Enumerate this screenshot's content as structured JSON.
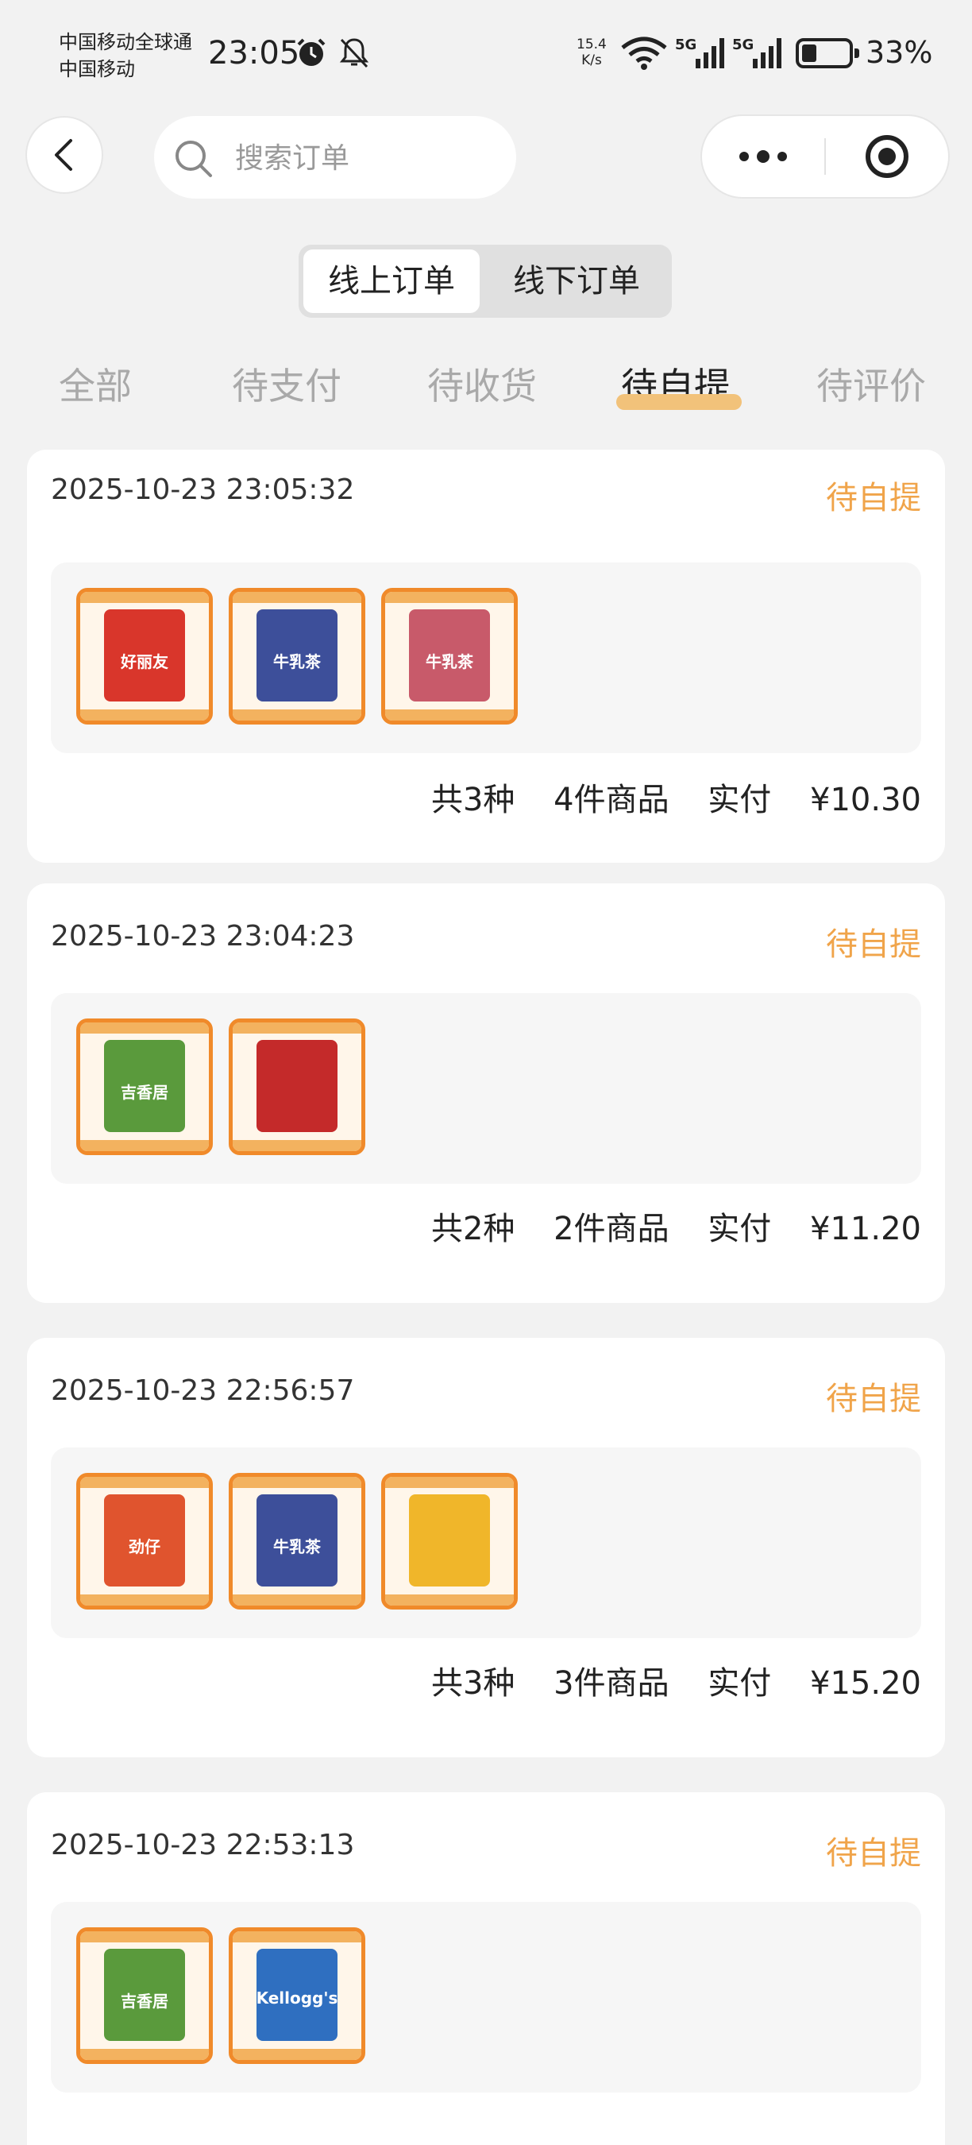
{
  "status_bar": {
    "carrier_line1": "中国移动全球通",
    "carrier_line2": "中国移动",
    "time": "23:05",
    "net_speed_value": "15.4",
    "net_speed_unit": "K/s",
    "battery": "33%",
    "battery_level": 0.33,
    "signal_label_1": "5G",
    "signal_label_2": "5G"
  },
  "nav": {
    "search_placeholder": "搜索订单"
  },
  "segmented": {
    "online": "线上订单",
    "offline": "线下订单",
    "selected": "线上订单"
  },
  "tabs": {
    "items": [
      "全部",
      "待支付",
      "待收货",
      "待自提",
      "待评价"
    ],
    "active": "待自提"
  },
  "colors": {
    "accent": "#f0a44a",
    "tab_underline": "#f2c27a",
    "thumb_border": "#f08a2a"
  },
  "orders": [
    {
      "time": "2025-10-23  23:05:32",
      "status": "待自提",
      "kinds": "共3种",
      "count": "4件商品",
      "paid_label": "实付",
      "amount": "¥10.30",
      "products": [
        {
          "name": "好丽友",
          "color": "#d9362b"
        },
        {
          "name": "牛乳茶",
          "color": "#3d4f9a"
        },
        {
          "name": "牛乳茶",
          "color": "#c85a6a"
        }
      ]
    },
    {
      "time": "2025-10-23  23:04:23",
      "status": "待自提",
      "kinds": "共2种",
      "count": "2件商品",
      "paid_label": "实付",
      "amount": "¥11.20",
      "products": [
        {
          "name": "吉香居",
          "color": "#5a9a3c"
        },
        {
          "name": "",
          "color": "#c42a2a"
        }
      ]
    },
    {
      "time": "2025-10-23  22:56:57",
      "status": "待自提",
      "kinds": "共3种",
      "count": "3件商品",
      "paid_label": "实付",
      "amount": "¥15.20",
      "products": [
        {
          "name": "劲仔",
          "color": "#e0542e"
        },
        {
          "name": "牛乳茶",
          "color": "#3d4f9a"
        },
        {
          "name": "",
          "color": "#f0b62a"
        }
      ]
    },
    {
      "time": "2025-10-23  22:53:13",
      "status": "待自提",
      "kinds": "",
      "count": "",
      "paid_label": "",
      "amount": "",
      "products": [
        {
          "name": "吉香居",
          "color": "#5a9a3c"
        },
        {
          "name": "Kellogg's",
          "color": "#2f6fc0"
        }
      ]
    }
  ]
}
